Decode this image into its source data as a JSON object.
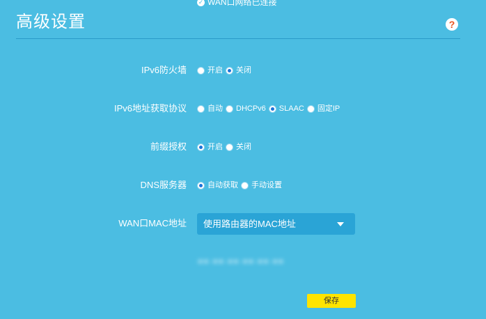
{
  "status": {
    "text": "WAN口网络已连接",
    "icon": "check-circle-icon"
  },
  "page": {
    "title": "高级设置",
    "help_label": "?"
  },
  "colors": {
    "background": "#4bbde2",
    "select_bg": "#2aa4d6",
    "save_bg": "#ffe400",
    "radio_dot": "#1a73d9",
    "help_icon": "#e8541f"
  },
  "settings": {
    "firewall": {
      "label": "IPv6防火墙",
      "options": [
        "开启",
        "关闭"
      ],
      "selected": "关闭"
    },
    "addr_protocol": {
      "label": "IPv6地址获取协议",
      "options": [
        "自动",
        "DHCPv6",
        "SLAAC",
        "固定IP"
      ],
      "selected": "SLAAC"
    },
    "prefix": {
      "label": "前缀授权",
      "options": [
        "开启",
        "关闭"
      ],
      "selected": "开启"
    },
    "dns": {
      "label": "DNS服务器",
      "options": [
        "自动获取",
        "手动设置"
      ],
      "selected": "自动获取"
    },
    "wan_mac": {
      "label": "WAN口MAC地址",
      "value": "使用路由器的MAC地址",
      "mac": "■■-■■-■■-■■-■■-■■"
    }
  },
  "actions": {
    "save_label": "保存"
  }
}
